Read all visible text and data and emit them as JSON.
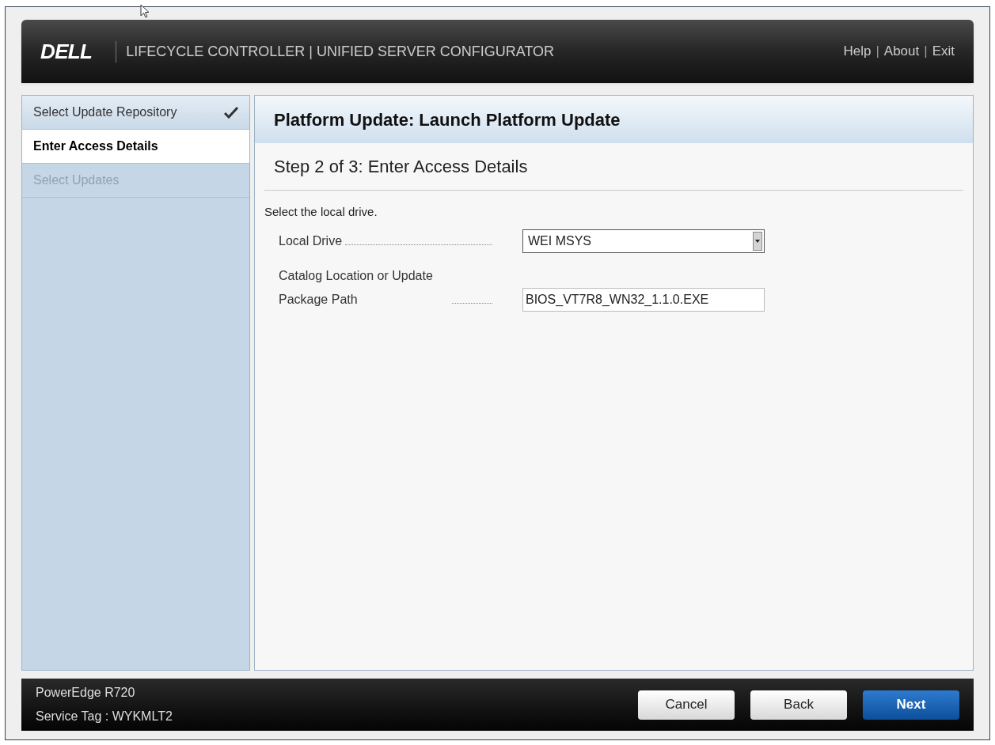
{
  "header": {
    "logo": "DELL",
    "title": "LIFECYCLE CONTROLLER | UNIFIED SERVER CONFIGURATOR",
    "links": [
      "Help",
      "About",
      "Exit"
    ],
    "separator": "|"
  },
  "steps": [
    {
      "label": "Select Update Repository",
      "selected": false,
      "completed": true,
      "disabled": false
    },
    {
      "label": "Enter Access Details",
      "selected": true,
      "completed": false,
      "disabled": false
    },
    {
      "label": "Select Updates",
      "selected": false,
      "completed": false,
      "disabled": true
    }
  ],
  "panel": {
    "title": "Platform Update: Launch Platform Update",
    "step_title": "Step 2 of 3: Enter Access Details",
    "instruction": "Select the local drive.",
    "fields": [
      {
        "kind": "dropdown",
        "label": "Local Drive",
        "value": "WEI MSYS"
      },
      {
        "kind": "text",
        "label": "Catalog Location or Update Package Path",
        "value": "BIOS_VT7R8_WN32_1.1.0.EXE"
      }
    ]
  },
  "footer": {
    "model": "PowerEdge R720",
    "service_tag": "Service Tag : WYKMLT2",
    "buttons": [
      {
        "label": "Cancel",
        "primary": false
      },
      {
        "label": "Back",
        "primary": false
      },
      {
        "label": "Next",
        "primary": true
      }
    ]
  }
}
